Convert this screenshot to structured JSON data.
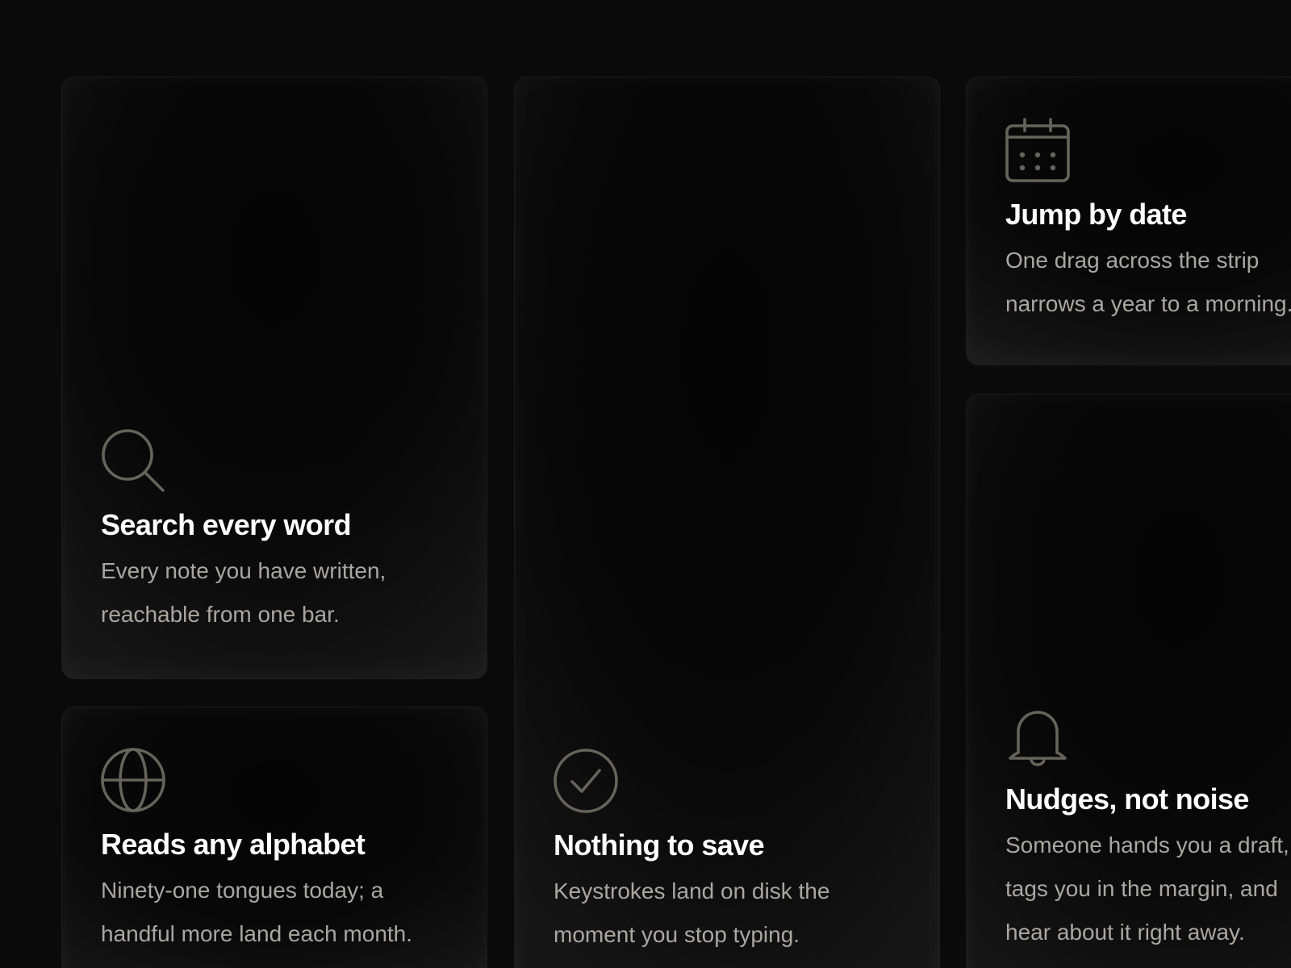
{
  "colors": {
    "background": "#0a0a0a",
    "card_border": "#1c1c1b",
    "icon_stroke": "#66645a",
    "title": "#ffffff",
    "description": "#a9a7a1"
  },
  "features": [
    {
      "id": "search",
      "icon": "search-icon",
      "title": "Search every word",
      "desc_line1": "Every note you have written,",
      "desc_line2": "reachable from one bar."
    },
    {
      "id": "date",
      "icon": "calendar-icon",
      "title": "Jump by date",
      "desc_line1": "One drag across the strip",
      "desc_line2": "narrows a year to a morning."
    },
    {
      "id": "alphabet",
      "icon": "globe-icon",
      "title": "Reads any alphabet",
      "desc_line1": "Ninety-one tongues today; a",
      "desc_line2": "handful more land each month."
    },
    {
      "id": "save",
      "icon": "check-circle-icon",
      "title": "Nothing to save",
      "desc_line1": "Keystrokes land on disk the",
      "desc_line2": "moment you stop typing."
    },
    {
      "id": "nudges",
      "icon": "bell-icon",
      "title": "Nudges, not noise",
      "desc_line1": "Someone hands you a draft,",
      "desc_line2": "tags you in the margin, and",
      "desc_line3": "hear about it right away."
    }
  ]
}
